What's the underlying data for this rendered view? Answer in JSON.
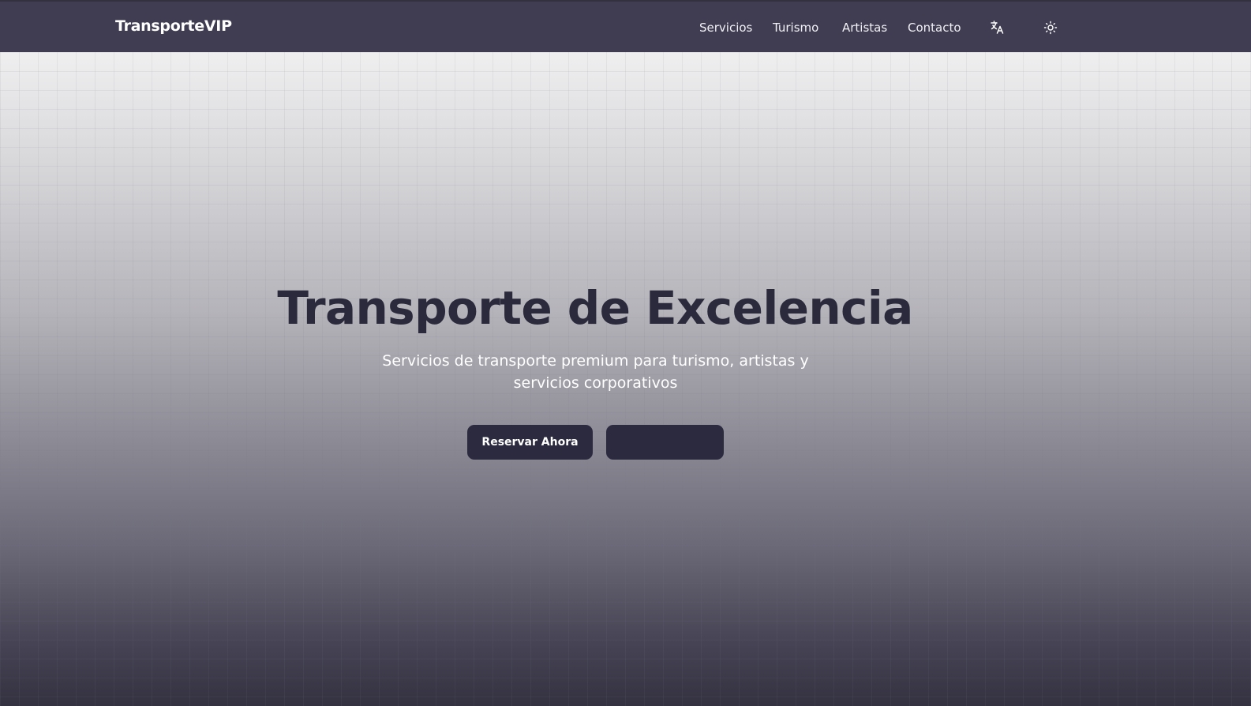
{
  "header": {
    "brand": "TransporteVIP",
    "nav": [
      {
        "label": "Servicios"
      },
      {
        "label": "Turismo"
      },
      {
        "label": "Artistas"
      },
      {
        "label": "Contacto"
      }
    ],
    "language_icon": "translate-icon",
    "theme_icon": "sun-icon"
  },
  "hero": {
    "title": "Transporte de Excelencia",
    "subtitle": "Servicios de transporte premium para turismo, artistas y servicios corporativos",
    "primary_button": "Reservar Ahora",
    "secondary_button": ""
  },
  "colors": {
    "header_bg": "#403d52",
    "title_text": "#2a2a3c",
    "button_bg": "#2b2a3f"
  }
}
